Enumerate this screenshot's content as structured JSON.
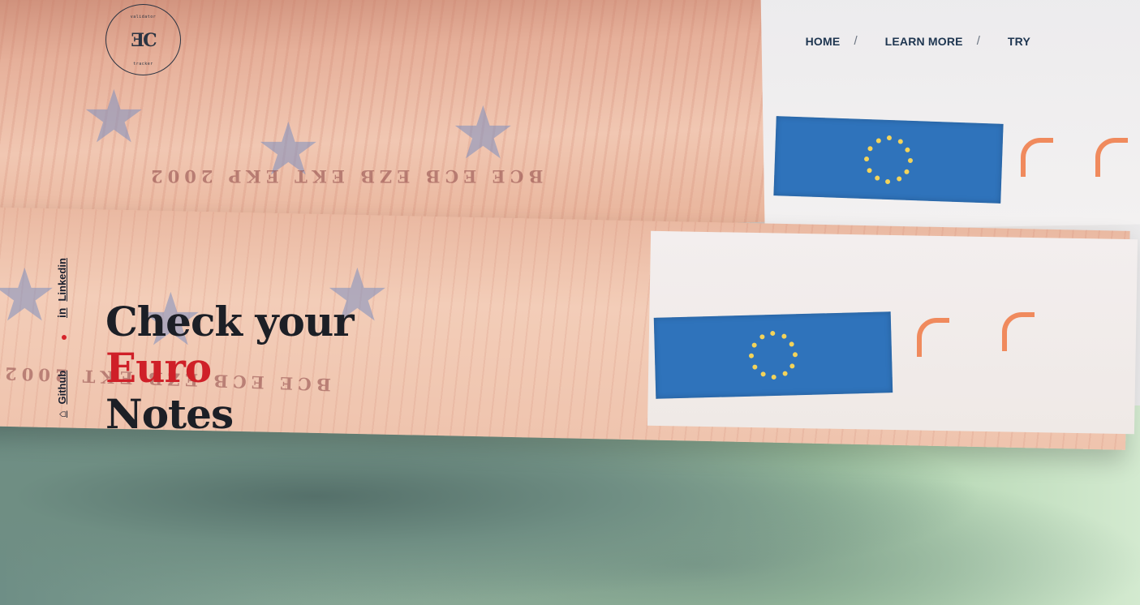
{
  "logo": {
    "top_text": "validator",
    "mark": "ƎC",
    "bottom_text": "tracker"
  },
  "nav": {
    "items": [
      {
        "label": "HOME"
      },
      {
        "label": "LEARN MORE"
      },
      {
        "label": "TRY"
      }
    ],
    "separator": "/"
  },
  "socials": {
    "linkedin_label": "Linkedin",
    "linkedin_icon": "in",
    "github_label": "Github",
    "github_icon": "⌂"
  },
  "hero": {
    "line1": "Check your",
    "line2": "Euro",
    "line3": "Notes"
  },
  "colors": {
    "accent": "#cf2028",
    "nav_text": "#1e3550",
    "heading": "#1c1f26"
  }
}
